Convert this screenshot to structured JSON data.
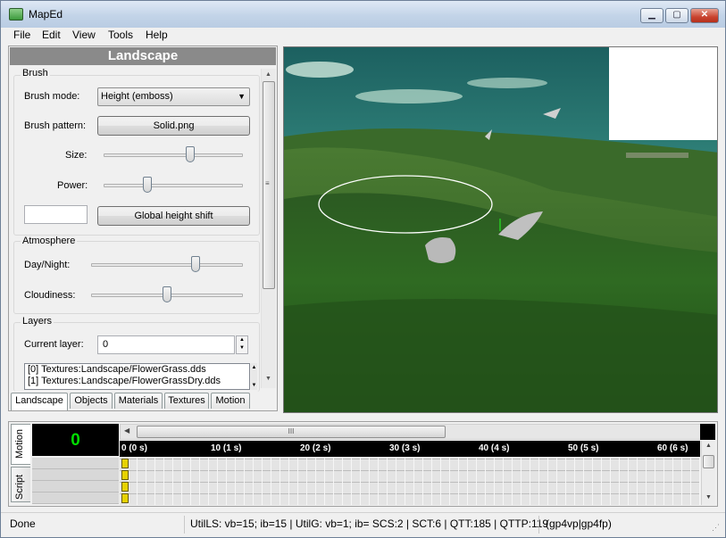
{
  "window": {
    "title": "MapEd"
  },
  "menu": [
    "File",
    "Edit",
    "View",
    "Tools",
    "Help"
  ],
  "panel": {
    "title": "Landscape",
    "brush": {
      "group_label": "Brush",
      "mode_label": "Brush mode:",
      "mode_value": "Height (emboss)",
      "pattern_label": "Brush pattern:",
      "pattern_value": "Solid.png",
      "size_label": "Size:",
      "size_level": 0.63,
      "power_label": "Power:",
      "power_level": 0.3,
      "height_shift_value": "",
      "height_shift_button": "Global height shift"
    },
    "atmosphere": {
      "group_label": "Atmosphere",
      "daynight_label": "Day/Night:",
      "daynight_level": 0.7,
      "cloudiness_label": "Cloudiness:",
      "cloudiness_level": 0.5
    },
    "layers": {
      "group_label": "Layers",
      "current_label": "Current layer:",
      "current_value": "0",
      "items": [
        "[0] Textures:Landscape/FlowerGrass.dds",
        "[1] Textures:Landscape/FlowerGrassDry.dds"
      ]
    },
    "tabs": [
      "Landscape",
      "Objects",
      "Materials",
      "Textures",
      "Motion"
    ],
    "active_tab": "Landscape"
  },
  "timeline": {
    "side_tabs": [
      "Motion",
      "Script"
    ],
    "frame_counter": "0",
    "scroll_thumb_glyph": "III",
    "marks": [
      "0 (0 s)",
      "10 (1 s)",
      "20 (2 s)",
      "30 (3 s)",
      "40 (4 s)",
      "50 (5 s)",
      "60 (6 s)"
    ],
    "counter_color": "#00dd00"
  },
  "status": {
    "left": "Done",
    "center": "UtilLS: vb=15; ib=15 | UtilG: vb=1; ib= SCS:2 | SCT:6 | QTT:185 | QTTP:119",
    "right": "(gp4vp|gp4fp)"
  },
  "icons": {
    "app": "maped-app-icon",
    "minimize": "minimize-icon",
    "maximize": "maximize-icon",
    "close": "close-icon",
    "dropdown": "chevron-down-icon"
  }
}
